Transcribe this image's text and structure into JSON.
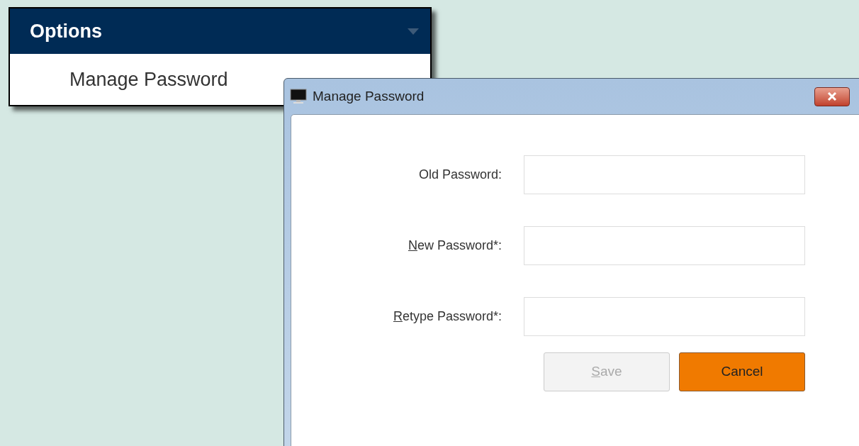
{
  "menu": {
    "title": "Options",
    "items": [
      {
        "label": "Manage Password"
      }
    ]
  },
  "dialog": {
    "title": "Manage Password",
    "fields": [
      {
        "label": {
          "text": "Old Password:"
        }
      },
      {
        "label": {
          "access_key": "N",
          "text": "ew Password*:"
        }
      },
      {
        "label": {
          "access_key": "R",
          "text": "etype Password*:"
        }
      }
    ],
    "buttons": [
      {
        "access_key": "S",
        "text": "ave",
        "disabled": true,
        "highlighted": false
      },
      {
        "text": "Cancel",
        "disabled": false,
        "highlighted": true
      }
    ]
  }
}
